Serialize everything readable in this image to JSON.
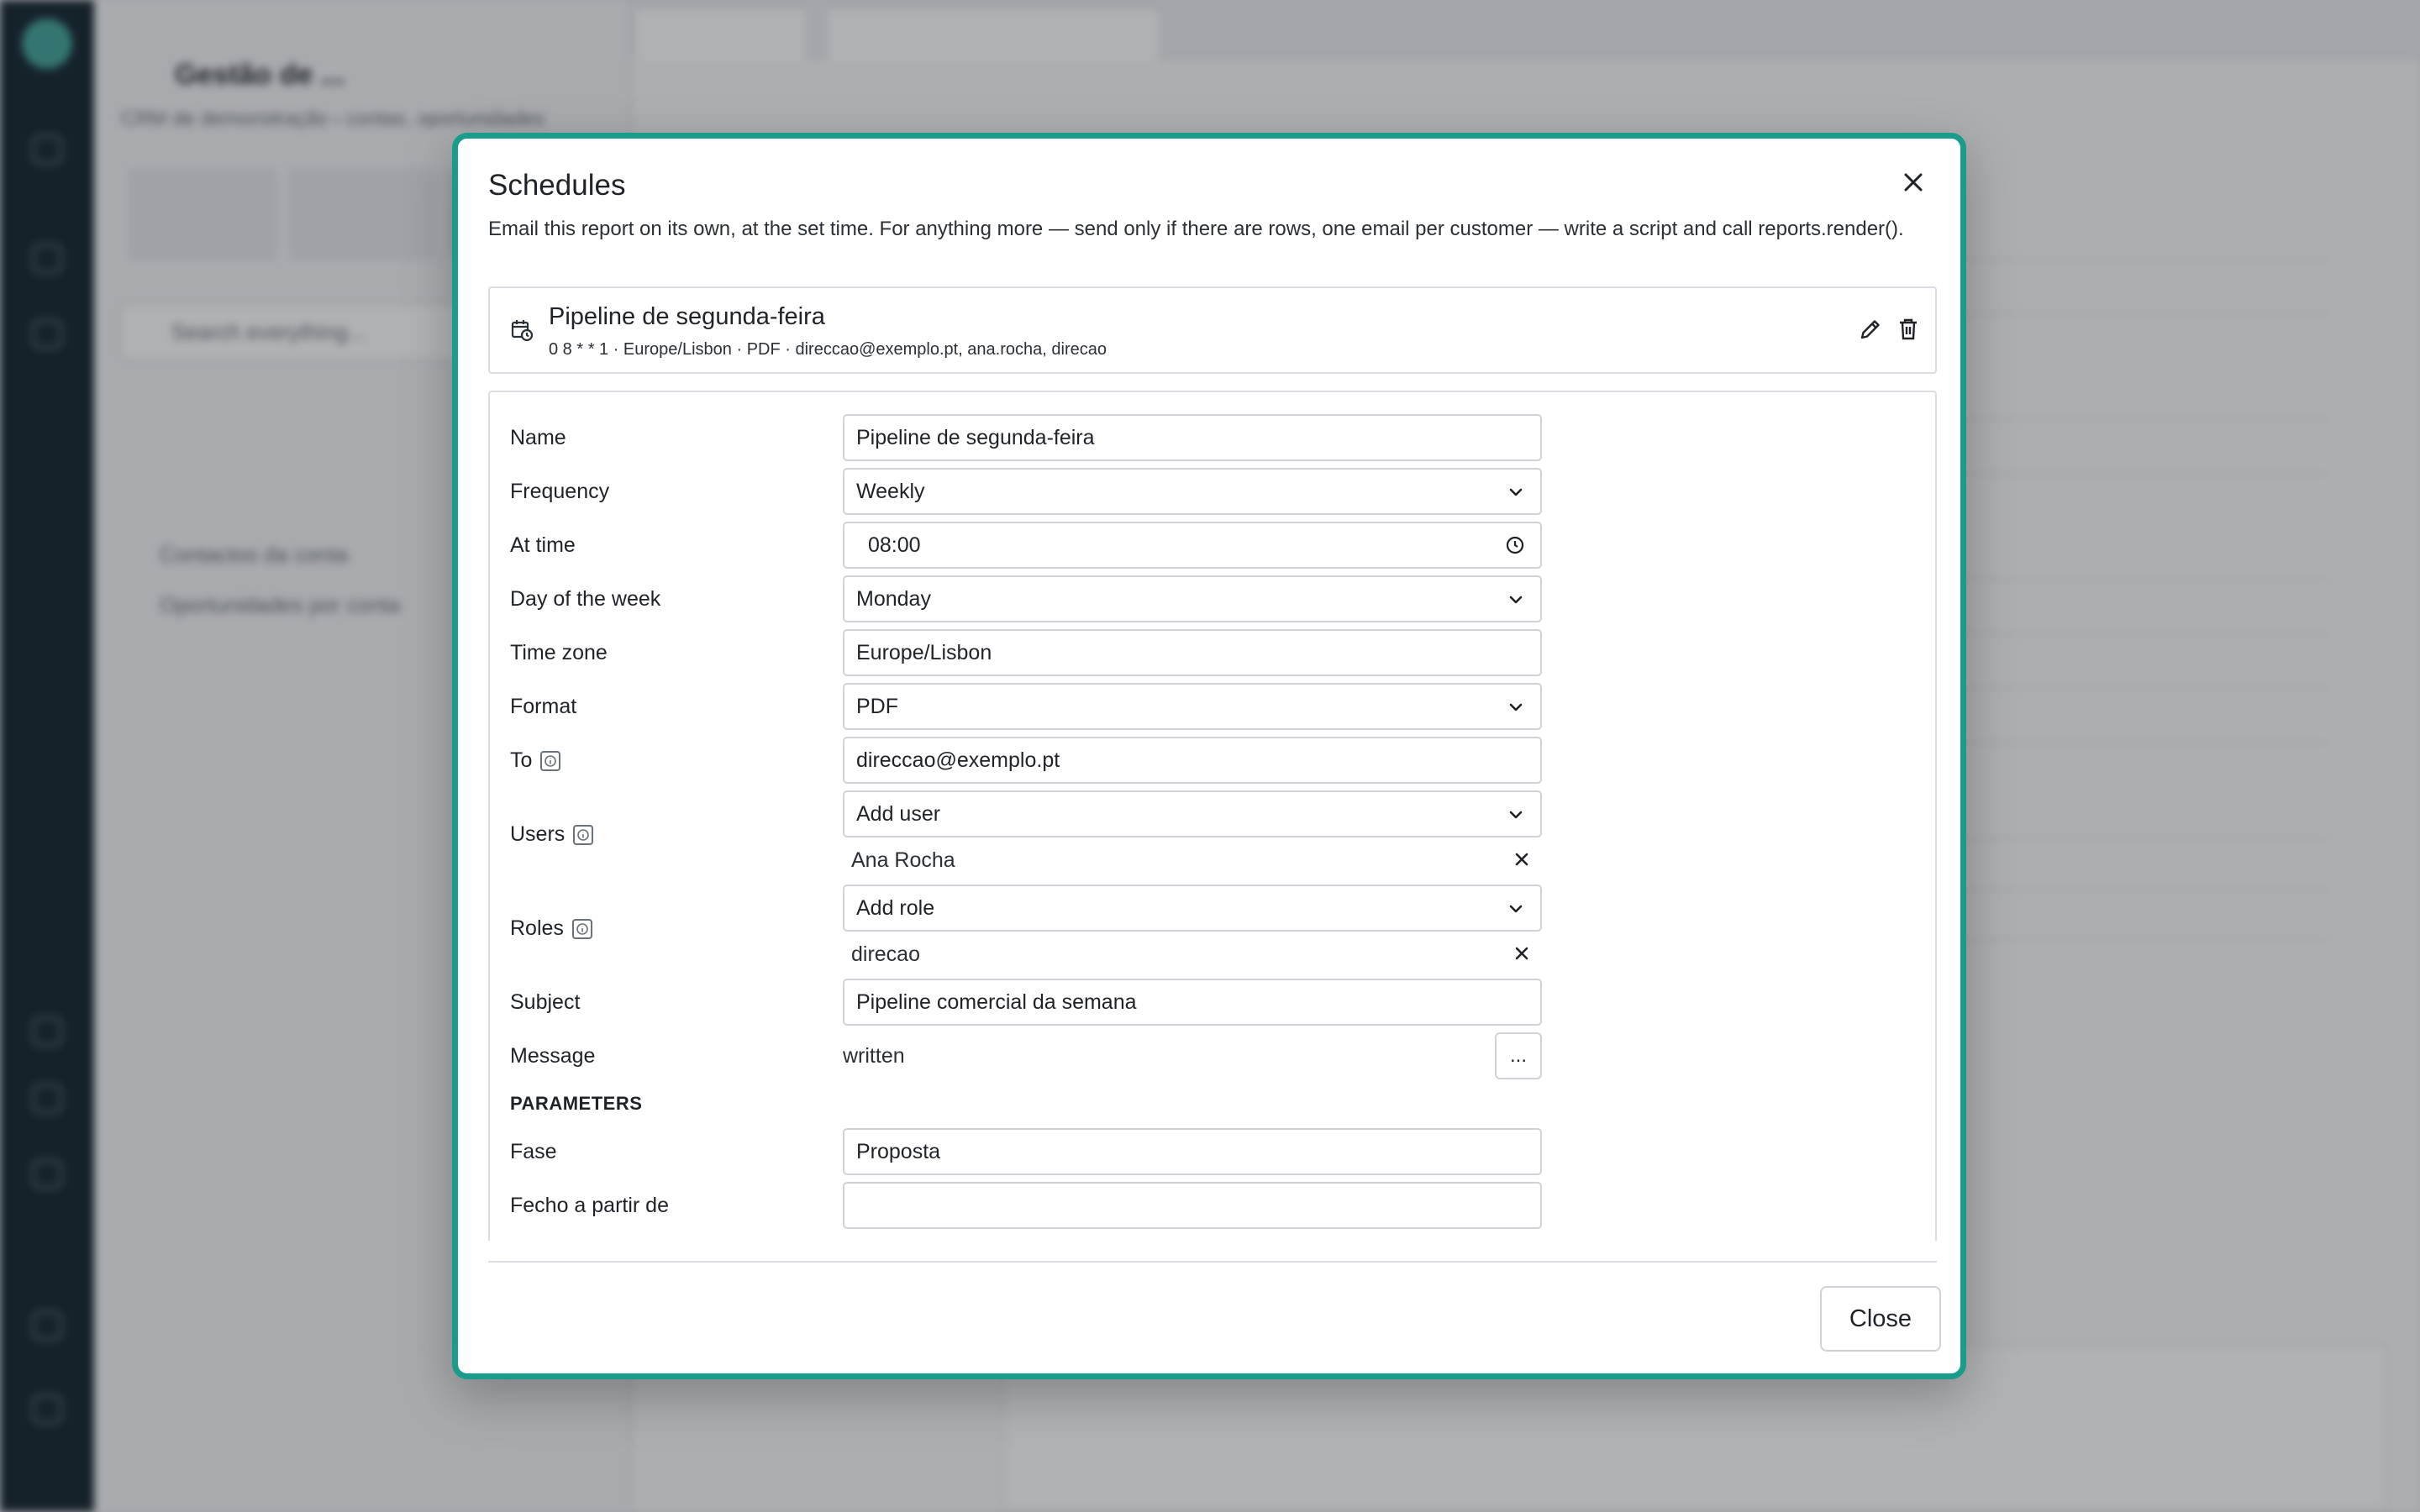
{
  "dialog": {
    "title": "Schedules",
    "description": "Email this report on its own, at the set time. For anything more — send only if there are rows, one email per customer — write a script and call reports.render().",
    "close_label": "Close"
  },
  "schedule_card": {
    "name": "Pipeline de segunda-feira",
    "meta": "0 8 * * 1 · Europe/Lisbon · PDF · direccao@exemplo.pt, ana.rocha, direcao"
  },
  "form": {
    "name": {
      "label": "Name",
      "value": "Pipeline de segunda-feira"
    },
    "frequency": {
      "label": "Frequency",
      "value": "Weekly"
    },
    "at_time": {
      "label": "At time",
      "value": "08:00"
    },
    "day_of_week": {
      "label": "Day of the week",
      "value": "Monday"
    },
    "time_zone": {
      "label": "Time zone",
      "value": "Europe/Lisbon"
    },
    "format": {
      "label": "Format",
      "value": "PDF"
    },
    "to": {
      "label": "To",
      "value": "direccao@exemplo.pt"
    },
    "users": {
      "label": "Users",
      "placeholder": "Add user",
      "items": [
        "Ana Rocha"
      ]
    },
    "roles": {
      "label": "Roles",
      "placeholder": "Add role",
      "items": [
        "direcao"
      ]
    },
    "subject": {
      "label": "Subject",
      "value": "Pipeline comercial da semana"
    },
    "message": {
      "label": "Message",
      "value": "written",
      "button": "..."
    },
    "parameters_heading": "PARAMETERS",
    "fase": {
      "label": "Fase",
      "value": "Proposta"
    },
    "fecho": {
      "label": "Fecho a partir de",
      "value": ""
    }
  },
  "background": {
    "sidebar_title": "Gestão de ...",
    "sidebar_subtitle": "CRM de demonstração › contas, oportunidades",
    "search_placeholder": "Search everything...",
    "items": [
      "Contactos da conta",
      "Oportunidades por conta"
    ]
  },
  "colors": {
    "accent": "#1a9c8c",
    "rail": "#1c2b33"
  }
}
